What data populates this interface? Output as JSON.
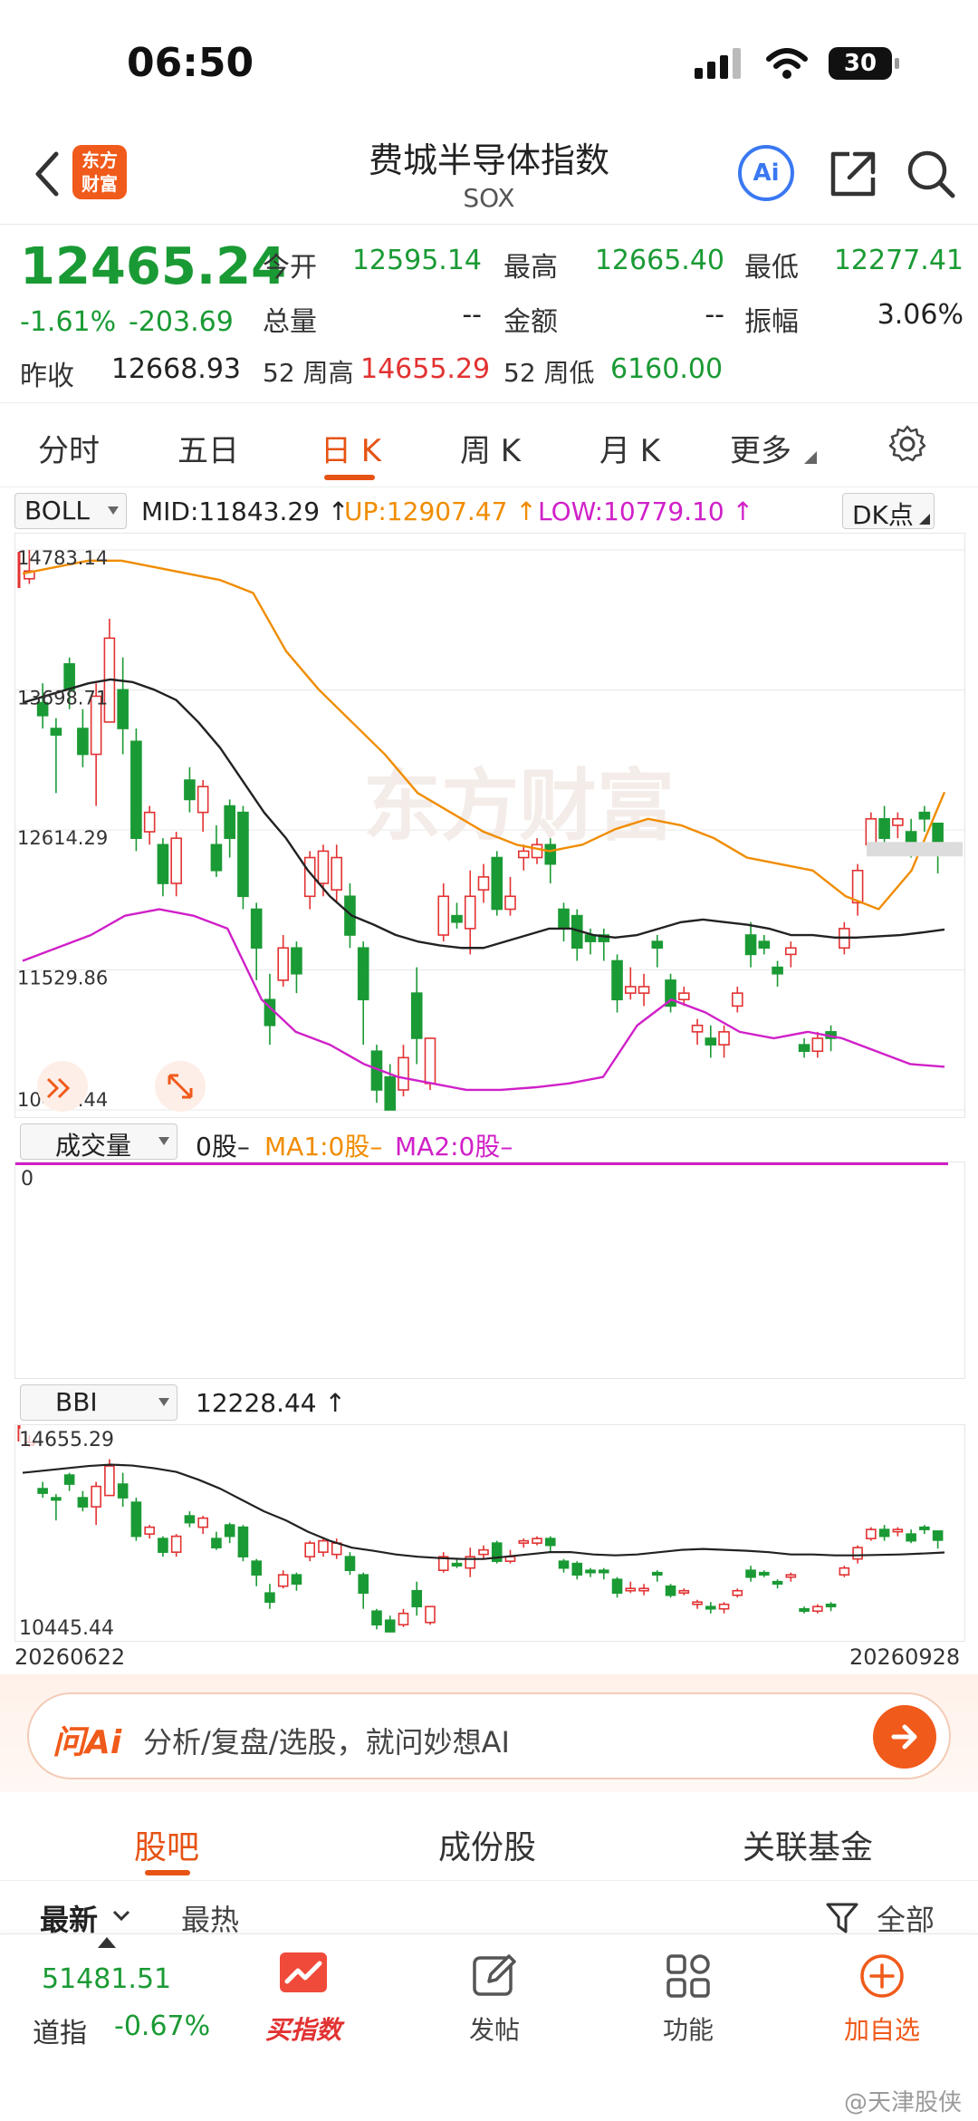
{
  "status": {
    "time": "06:50",
    "battery": "30"
  },
  "header": {
    "logo_line1": "东方",
    "logo_line2": "财富",
    "title": "费城半导体指数",
    "subtitle": "SOX",
    "ai_label": "Ai"
  },
  "quote": {
    "price": "12465.24",
    "change_pct": "-1.61%",
    "change_abs": "-203.69",
    "open_label": "今开",
    "open": "12595.14",
    "high_label": "最高",
    "high": "12665.40",
    "low_label": "最低",
    "low": "12277.41",
    "volume_label": "总量",
    "volume": "--",
    "amount_label": "金额",
    "amount": "--",
    "amplitude_label": "振幅",
    "amplitude": "3.06%",
    "prev_label": "昨收",
    "prev": "12668.93",
    "wk52_high_label": "52 周高",
    "wk52_high": "14655.29",
    "wk52_low_label": "52 周低",
    "wk52_low": "6160.00"
  },
  "tabs": [
    "分时",
    "五日",
    "日 K",
    "周 K",
    "月 K",
    "更多"
  ],
  "boll": {
    "select": "BOLL",
    "mid": "MID:11843.29 ↑",
    "up": "UP:12907.47 ↑",
    "low": "LOW:10779.10 ↑",
    "dk": "DK点"
  },
  "vol": {
    "select": "成交量",
    "val": "0股–",
    "ma1": "MA1:0股–",
    "ma2": "MA2:0股–",
    "zero": "0"
  },
  "bbi": {
    "select": "BBI",
    "val": "12228.44 ↑",
    "top": "14655.29",
    "bottom": "10445.44"
  },
  "dates": {
    "start": "20260622",
    "end": "20260928"
  },
  "chart_data": {
    "type": "candlestick",
    "yticks": [
      "14783.14",
      "13698.71",
      "12614.29",
      "11529.86",
      "10445.44"
    ],
    "watermark": "东方财富",
    "ylim": [
      10445.44,
      14783.14
    ],
    "candles": [
      {
        "o": 14560,
        "c": 14620,
        "h": 14783,
        "l": 14520
      },
      {
        "o": 13600,
        "c": 13500,
        "h": 13750,
        "l": 13400
      },
      {
        "o": 13400,
        "c": 13350,
        "h": 13480,
        "l": 12900
      },
      {
        "o": 13900,
        "c": 13700,
        "h": 13950,
        "l": 13550
      },
      {
        "o": 13400,
        "c": 13200,
        "h": 13550,
        "l": 13100
      },
      {
        "o": 13200,
        "c": 13650,
        "h": 13750,
        "l": 12800
      },
      {
        "o": 13450,
        "c": 14100,
        "h": 14250,
        "l": 13450
      },
      {
        "o": 13700,
        "c": 13400,
        "h": 13950,
        "l": 13200
      },
      {
        "o": 13300,
        "c": 12550,
        "h": 13400,
        "l": 12450
      },
      {
        "o": 12600,
        "c": 12750,
        "h": 12800,
        "l": 12500
      },
      {
        "o": 12500,
        "c": 12200,
        "h": 12550,
        "l": 12100
      },
      {
        "o": 12200,
        "c": 12550,
        "h": 12600,
        "l": 12100
      },
      {
        "o": 13000,
        "c": 12850,
        "h": 13100,
        "l": 12750
      },
      {
        "o": 12750,
        "c": 12950,
        "h": 13000,
        "l": 12600
      },
      {
        "o": 12500,
        "c": 12300,
        "h": 12650,
        "l": 12250
      },
      {
        "o": 12800,
        "c": 12550,
        "h": 12850,
        "l": 12400
      },
      {
        "o": 12750,
        "c": 12100,
        "h": 12800,
        "l": 12000
      },
      {
        "o": 12000,
        "c": 11700,
        "h": 12050,
        "l": 11450
      },
      {
        "o": 11300,
        "c": 11100,
        "h": 11500,
        "l": 10950
      },
      {
        "o": 11450,
        "c": 11700,
        "h": 11800,
        "l": 11400
      },
      {
        "o": 11700,
        "c": 11500,
        "h": 11750,
        "l": 11350
      },
      {
        "o": 12100,
        "c": 12400,
        "h": 12450,
        "l": 12000
      },
      {
        "o": 12200,
        "c": 12450,
        "h": 12500,
        "l": 12100
      },
      {
        "o": 12150,
        "c": 12400,
        "h": 12500,
        "l": 12050
      },
      {
        "o": 12100,
        "c": 11800,
        "h": 12200,
        "l": 11700
      },
      {
        "o": 11700,
        "c": 11300,
        "h": 11750,
        "l": 10950
      },
      {
        "o": 10900,
        "c": 10600,
        "h": 10950,
        "l": 10500
      },
      {
        "o": 10700,
        "c": 10445,
        "h": 10800,
        "l": 10445
      },
      {
        "o": 10600,
        "c": 10850,
        "h": 10950,
        "l": 10550
      },
      {
        "o": 11350,
        "c": 11000,
        "h": 11550,
        "l": 10800
      },
      {
        "o": 10650,
        "c": 11000,
        "h": 11000,
        "l": 10600
      },
      {
        "o": 11800,
        "c": 12100,
        "h": 12200,
        "l": 11750
      },
      {
        "o": 11950,
        "c": 11900,
        "h": 12050,
        "l": 11850
      },
      {
        "o": 11850,
        "c": 12100,
        "h": 12300,
        "l": 11650
      },
      {
        "o": 12150,
        "c": 12250,
        "h": 12350,
        "l": 12050
      },
      {
        "o": 12400,
        "c": 12000,
        "h": 12450,
        "l": 11950
      },
      {
        "o": 12000,
        "c": 12100,
        "h": 12250,
        "l": 11950
      },
      {
        "o": 12400,
        "c": 12450,
        "h": 12500,
        "l": 12300
      },
      {
        "o": 12400,
        "c": 12500,
        "h": 12550,
        "l": 12350
      },
      {
        "o": 12500,
        "c": 12350,
        "h": 12550,
        "l": 12200
      },
      {
        "o": 12000,
        "c": 11850,
        "h": 12050,
        "l": 11750
      },
      {
        "o": 11950,
        "c": 11700,
        "h": 12000,
        "l": 11600
      },
      {
        "o": 11800,
        "c": 11750,
        "h": 11850,
        "l": 11650
      },
      {
        "o": 11800,
        "c": 11750,
        "h": 11850,
        "l": 11600
      },
      {
        "o": 11600,
        "c": 11300,
        "h": 11650,
        "l": 11200
      },
      {
        "o": 11350,
        "c": 11400,
        "h": 11550,
        "l": 11300
      },
      {
        "o": 11350,
        "c": 11400,
        "h": 11500,
        "l": 11250
      },
      {
        "o": 11750,
        "c": 11700,
        "h": 11800,
        "l": 11550
      },
      {
        "o": 11450,
        "c": 11250,
        "h": 11500,
        "l": 11200
      },
      {
        "o": 11300,
        "c": 11350,
        "h": 11400,
        "l": 11250
      },
      {
        "o": 11050,
        "c": 11100,
        "h": 11150,
        "l": 10950
      },
      {
        "o": 11000,
        "c": 10950,
        "h": 11100,
        "l": 10850
      },
      {
        "o": 10950,
        "c": 11050,
        "h": 11100,
        "l": 10850
      },
      {
        "o": 11250,
        "c": 11350,
        "h": 11400,
        "l": 11200
      },
      {
        "o": 11800,
        "c": 11650,
        "h": 11900,
        "l": 11550
      },
      {
        "o": 11750,
        "c": 11700,
        "h": 11800,
        "l": 11650
      },
      {
        "o": 11550,
        "c": 11500,
        "h": 11600,
        "l": 11400
      },
      {
        "o": 11650,
        "c": 11700,
        "h": 11750,
        "l": 11550
      },
      {
        "o": 10950,
        "c": 10900,
        "h": 11000,
        "l": 10850
      },
      {
        "o": 10900,
        "c": 11000,
        "h": 11050,
        "l": 10850
      },
      {
        "o": 11050,
        "c": 11000,
        "h": 11100,
        "l": 10900
      },
      {
        "o": 11700,
        "c": 11850,
        "h": 11900,
        "l": 11650
      },
      {
        "o": 12050,
        "c": 12300,
        "h": 12350,
        "l": 11950
      },
      {
        "o": 12500,
        "c": 12700,
        "h": 12750,
        "l": 12450
      },
      {
        "o": 12700,
        "c": 12550,
        "h": 12800,
        "l": 12450
      },
      {
        "o": 12650,
        "c": 12700,
        "h": 12750,
        "l": 12550
      },
      {
        "o": 12600,
        "c": 12450,
        "h": 12700,
        "l": 12400
      },
      {
        "o": 12750,
        "c": 12700,
        "h": 12800,
        "l": 12600
      },
      {
        "o": 12665,
        "c": 12465,
        "h": 12665,
        "l": 12277
      }
    ],
    "mid": [
      13600,
      13650,
      13700,
      13750,
      13780,
      13760,
      13700,
      13620,
      13450,
      13250,
      13000,
      12750,
      12550,
      12300,
      12100,
      11950,
      11880,
      11800,
      11750,
      11720,
      11700,
      11700,
      11750,
      11800,
      11850,
      11850,
      11800,
      11780,
      11800,
      11850,
      11900,
      11920,
      11900,
      11880,
      11850,
      11800,
      11800,
      11780,
      11780,
      11790,
      11800,
      11820,
      11843
    ],
    "up": [
      14600,
      14650,
      14700,
      14700,
      14650,
      14600,
      14550,
      14450,
      14000,
      13700,
      13450,
      13200,
      12900,
      12750,
      12600,
      12500,
      12450,
      12500,
      12620,
      12700,
      12650,
      12550,
      12400,
      12350,
      12300,
      12100,
      12000,
      12300,
      12907
    ],
    "low": [
      11600,
      11700,
      11800,
      11950,
      12000,
      11950,
      11850,
      11300,
      11050,
      10950,
      10800,
      10700,
      10650,
      10600,
      10600,
      10620,
      10650,
      10700,
      11100,
      11300,
      11200,
      11050,
      11000,
      11050,
      11000,
      10900,
      10800,
      10779
    ]
  }
}
